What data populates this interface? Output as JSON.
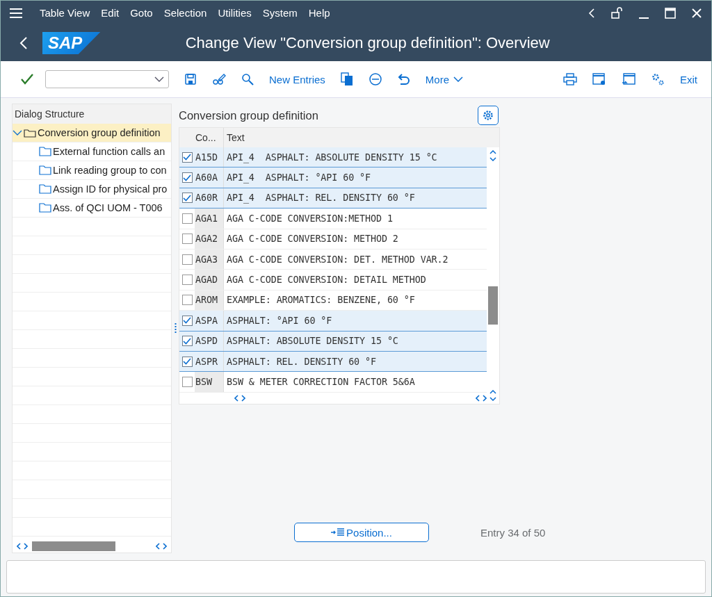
{
  "menu": [
    "Table View",
    "Edit",
    "Goto",
    "Selection",
    "Utilities",
    "System",
    "Help"
  ],
  "title": "Change View \"Conversion group definition\": Overview",
  "logo": "SAP",
  "toolbar": {
    "new_entries": "New Entries",
    "more": "More",
    "exit": "Exit"
  },
  "dialog_structure": {
    "title": "Dialog Structure",
    "tree": [
      {
        "label": "Conversion group definition",
        "selected": true,
        "expanded": true,
        "children": [
          {
            "label": "External function calls an",
            "selected": false
          },
          {
            "label": "Link reading group to con",
            "selected": false
          },
          {
            "label": "Assign ID for physical pro",
            "selected": false
          },
          {
            "label": "Ass. of QCI UOM - T006",
            "selected": false
          }
        ]
      }
    ]
  },
  "table": {
    "title": "Conversion group definition",
    "columns": [
      "Co...",
      "Text"
    ],
    "rows": [
      {
        "code": "A15D",
        "text": "API_4  ASPHALT: ABSOLUTE DENSITY 15 °C",
        "selected": true
      },
      {
        "code": "A60A",
        "text": "API_4  ASPHALT: °API 60 °F",
        "selected": true
      },
      {
        "code": "A60R",
        "text": "API_4  ASPHALT: REL. DENSITY 60 °F",
        "selected": true
      },
      {
        "code": "AGA1",
        "text": "AGA C-CODE CONVERSION:METHOD 1",
        "selected": false
      },
      {
        "code": "AGA2",
        "text": "AGA C-CODE CONVERSION: METHOD 2",
        "selected": false
      },
      {
        "code": "AGA3",
        "text": "AGA C-CODE CONVERSION: DET. METHOD VAR.2",
        "selected": false
      },
      {
        "code": "AGAD",
        "text": "AGA C-CODE CONVERSION: DETAIL METHOD",
        "selected": false
      },
      {
        "code": "AROM",
        "text": "EXAMPLE: AROMATICS: BENZENE, 60 °F",
        "selected": false
      },
      {
        "code": "ASPA",
        "text": "ASPHALT: °API 60 °F",
        "selected": true
      },
      {
        "code": "ASPD",
        "text": "ASPHALT: ABSOLUTE DENSITY 15 °C",
        "selected": true
      },
      {
        "code": "ASPR",
        "text": "ASPHALT: REL. DENSITY 60 °F",
        "selected": true
      },
      {
        "code": "BSW",
        "text": "BSW & METER CORRECTION FACTOR 5&6A",
        "selected": false
      }
    ]
  },
  "position_button": "Position...",
  "entry_info": "Entry 34 of 50"
}
